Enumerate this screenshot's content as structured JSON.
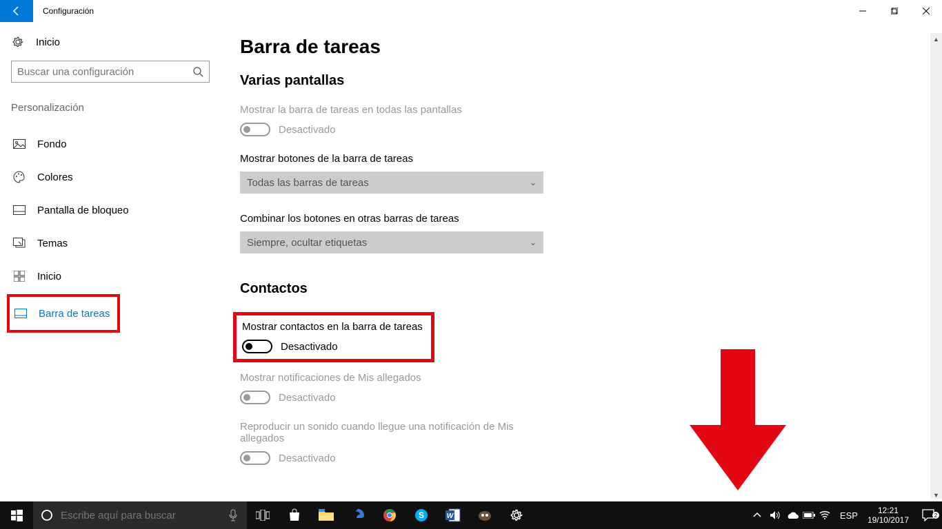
{
  "titlebar": {
    "title": "Configuración"
  },
  "sidebar": {
    "home": "Inicio",
    "search_placeholder": "Buscar una configuración",
    "group": "Personalización",
    "items": [
      {
        "label": "Fondo"
      },
      {
        "label": "Colores"
      },
      {
        "label": "Pantalla de bloqueo"
      },
      {
        "label": "Temas"
      },
      {
        "label": "Inicio"
      },
      {
        "label": "Barra de tareas"
      }
    ]
  },
  "main": {
    "title": "Barra de tareas",
    "section1": {
      "heading": "Varias pantallas",
      "s1_label": "Mostrar la barra de tareas en todas las pantallas",
      "s1_status": "Desactivado",
      "s2_label": "Mostrar botones de la barra de tareas",
      "s2_value": "Todas las barras de tareas",
      "s3_label": "Combinar los botones en otras barras de tareas",
      "s3_value": "Siempre, ocultar etiquetas"
    },
    "section2": {
      "heading": "Contactos",
      "c1_label": "Mostrar contactos en la barra de tareas",
      "c1_status": "Desactivado",
      "c2_label": "Mostrar notificaciones de Mis allegados",
      "c2_status": "Desactivado",
      "c3_label": "Reproducir un sonido cuando llegue una notificación de Mis allegados",
      "c3_status": "Desactivado"
    }
  },
  "taskbar": {
    "search_placeholder": "Escribe aquí para buscar",
    "lang": "ESP",
    "time": "12:21",
    "date": "19/10/2017"
  }
}
